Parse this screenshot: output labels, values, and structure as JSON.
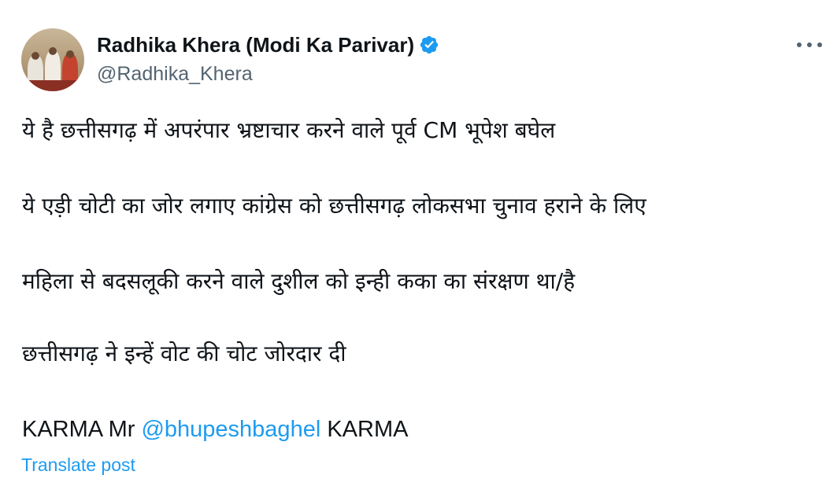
{
  "author": {
    "display_name": "Radhika Khera (Modi Ka Parivar)",
    "handle": "@Radhika_Khera",
    "verified_icon": "verified-badge-icon",
    "badge_color": "#1d9bf0"
  },
  "post": {
    "lines": [
      "ये है छत्तीसगढ़ में अपरंपार भ्रष्टाचार करने वाले पूर्व CM भूपेश बघेल",
      "ये एड़ी चोटी का जोर लगाए कांग्रेस को छत्तीसगढ़ लोकसभा चुनाव हराने के लिए",
      "महिला से बदसलूकी करने वाले दुशील को इन्ही कका का संरक्षण था/है",
      "छत्तीसगढ़ ने इन्हें वोट की चोट जोरदार दी"
    ],
    "last_line": {
      "prefix": "KARMA Mr ",
      "mention": "@bhupeshbaghel",
      "suffix": " KARMA"
    },
    "translate_label": "Translate post"
  },
  "colors": {
    "link": "#1d9bf0",
    "text": "#0f1419",
    "secondary": "#536471"
  }
}
